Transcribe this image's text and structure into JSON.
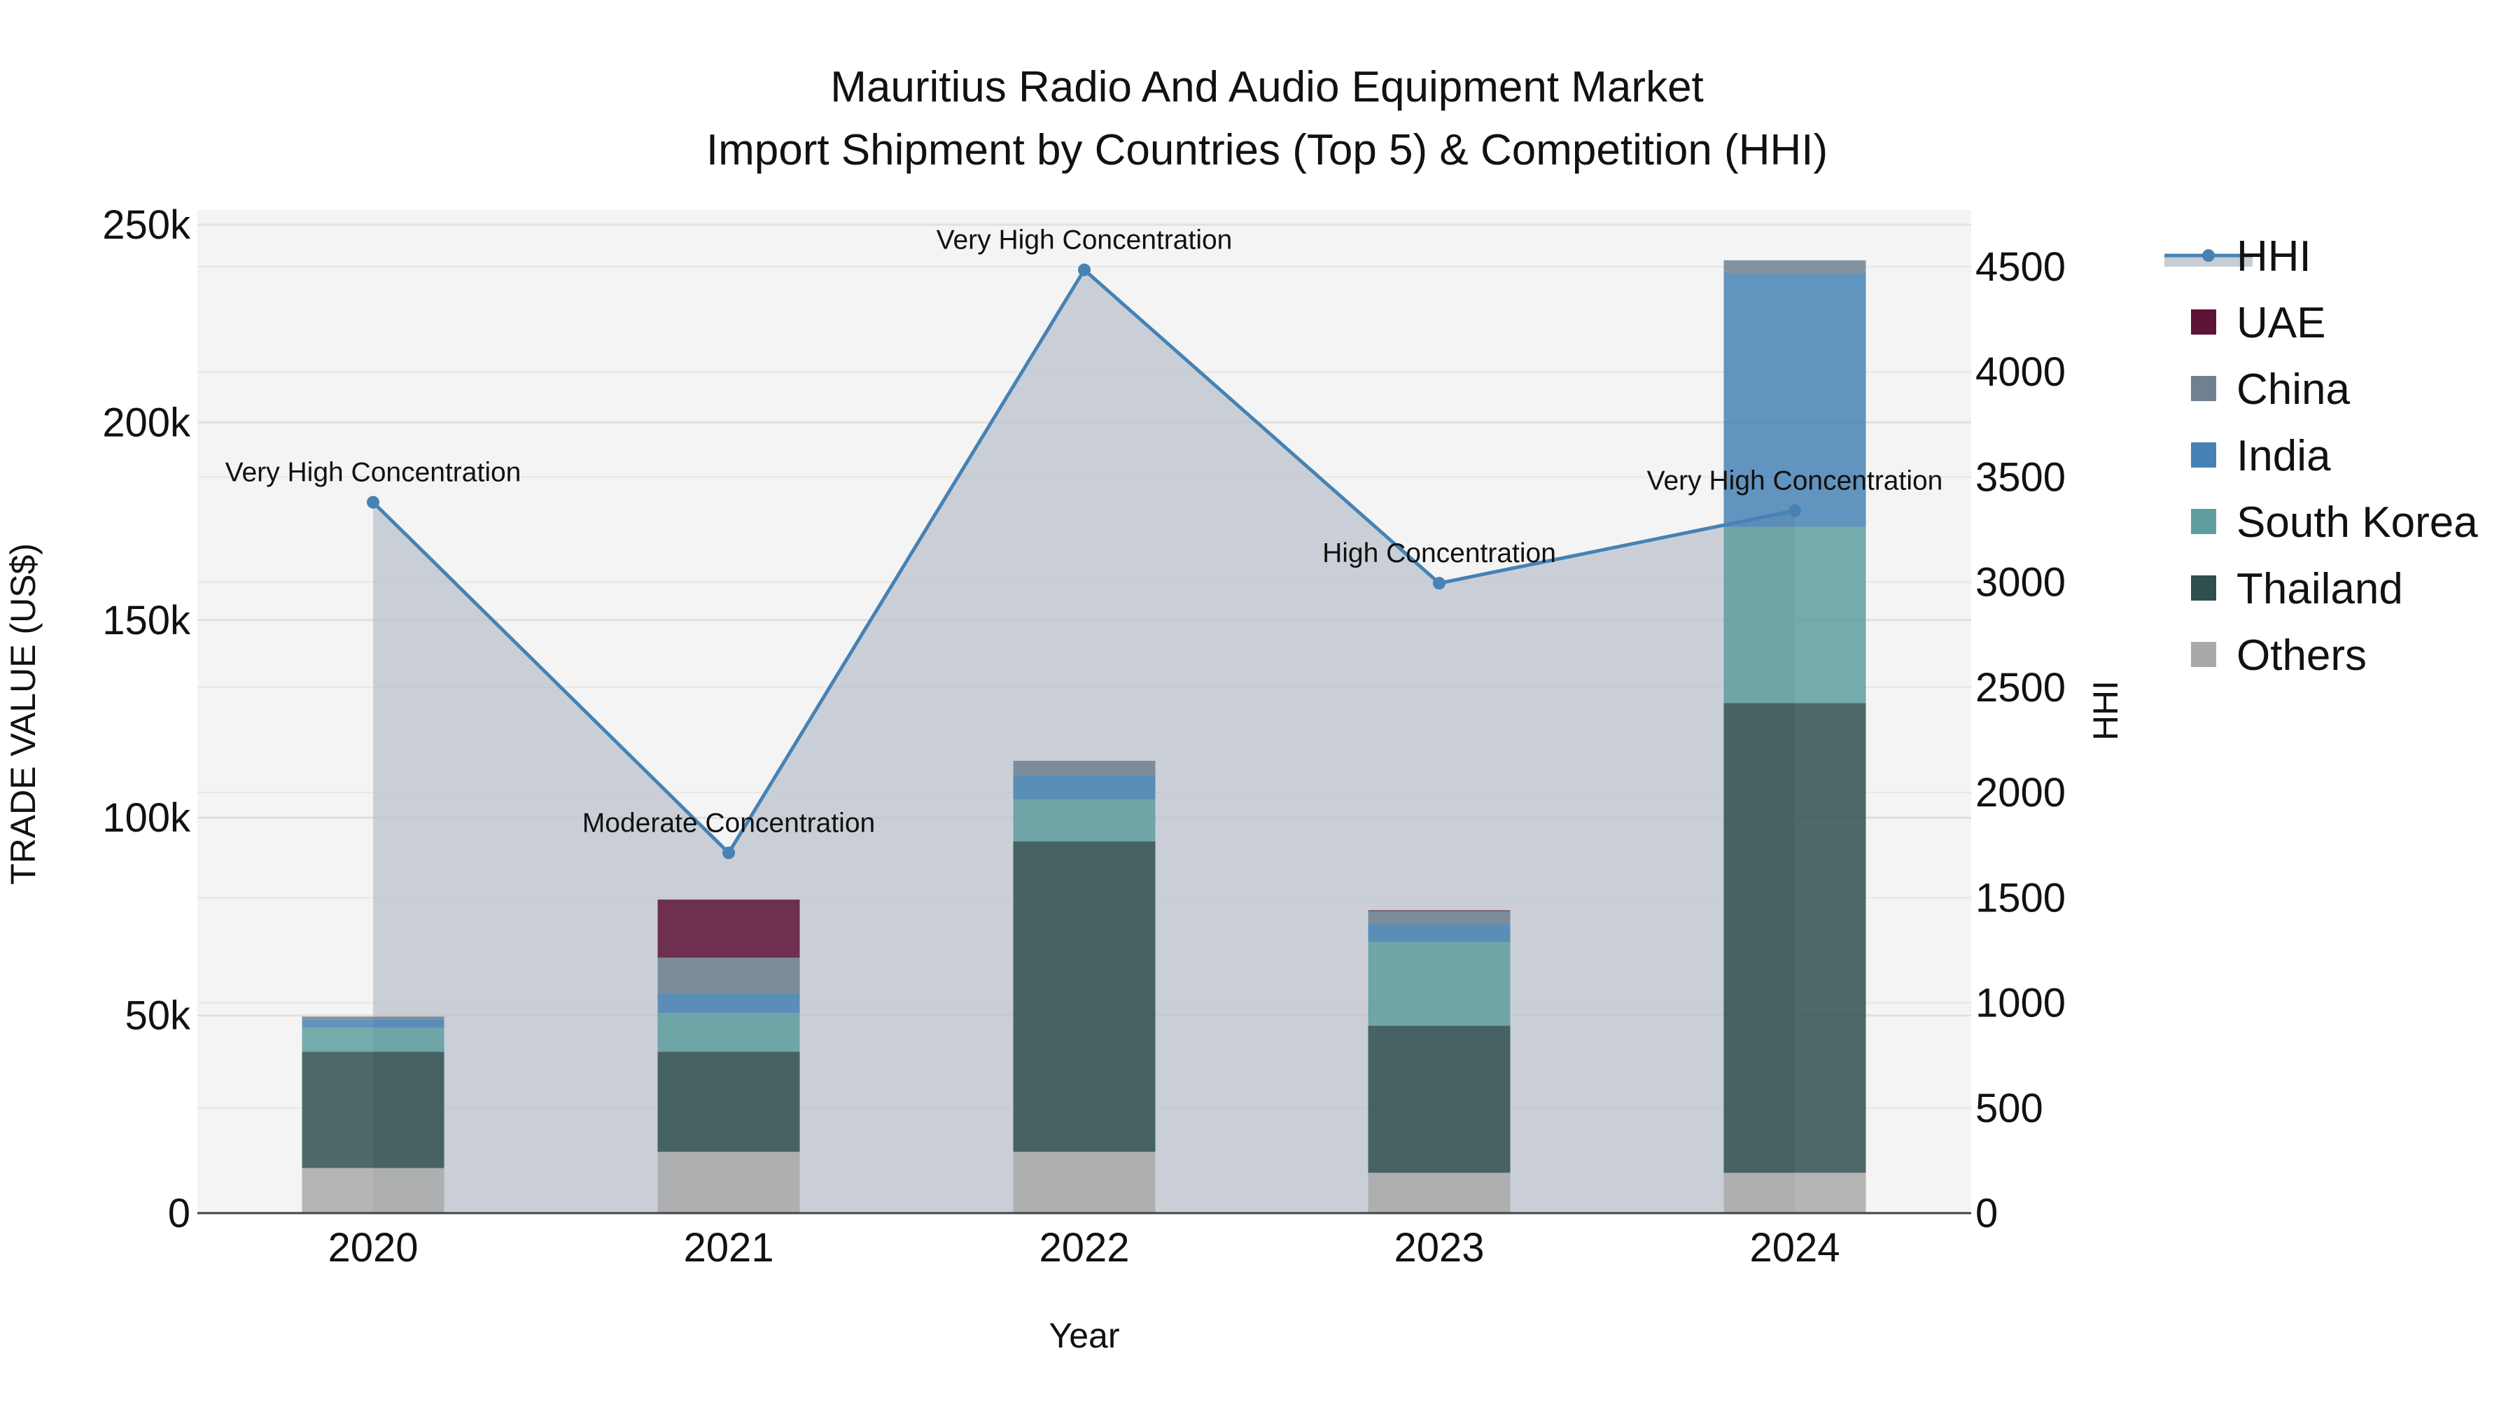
{
  "chart_data": {
    "type": "bar",
    "title": "Mauritius Radio And Audio Equipment Market",
    "subtitle": "Import Shipment by Countries (Top 5) & Competition (HHI)",
    "xlabel": "Year",
    "ylabel": "TRADE VALUE (US$)",
    "y2label": "HHI",
    "categories": [
      "2020",
      "2021",
      "2022",
      "2023",
      "2024"
    ],
    "ylim": [
      0,
      250000
    ],
    "y2lim": [
      0,
      4500
    ],
    "yticks": [
      0,
      50000,
      100000,
      150000,
      200000,
      250000
    ],
    "ytick_labels": [
      "0",
      "50k",
      "100k",
      "150k",
      "200k",
      "250k"
    ],
    "y2ticks": [
      0,
      500,
      1000,
      1500,
      2000,
      2500,
      3000,
      3500,
      4000,
      4500
    ],
    "y2tick_labels": [
      "0",
      "500",
      "1000",
      "1500",
      "2000",
      "2500",
      "3000",
      "3500",
      "4000",
      "4500"
    ],
    "stacked": true,
    "grid": true,
    "legend_position": "right",
    "series": [
      {
        "name": "Others",
        "color": "#a9a9a9",
        "values": [
          11400,
          15500,
          15500,
          10200,
          10200
        ]
      },
      {
        "name": "Thailand",
        "color": "#2f4f4f",
        "values": [
          29400,
          25300,
          78500,
          37200,
          118800
        ]
      },
      {
        "name": "South Korea",
        "color": "#5f9e9e",
        "values": [
          6100,
          9800,
          10600,
          21200,
          44600
        ]
      },
      {
        "name": "India",
        "color": "#4682b4",
        "values": [
          2000,
          5000,
          6100,
          4500,
          64100
        ]
      },
      {
        "name": "China",
        "color": "#708090",
        "values": [
          800,
          9000,
          3700,
          3300,
          3300
        ]
      },
      {
        "name": "UAE",
        "color": "#5e1436",
        "values": [
          0,
          14700,
          0,
          200,
          0
        ]
      }
    ],
    "hhi": {
      "name": "HHI",
      "color": "#4682b4",
      "values": [
        3380,
        1713,
        4485,
        2995,
        3340
      ],
      "annotations": [
        "Very High Concentration",
        "Moderate Concentration",
        "Very High Concentration",
        "High Concentration",
        "Very High Concentration"
      ]
    },
    "legend": [
      "HHI",
      "UAE",
      "China",
      "India",
      "South Korea",
      "Thailand",
      "Others"
    ]
  }
}
